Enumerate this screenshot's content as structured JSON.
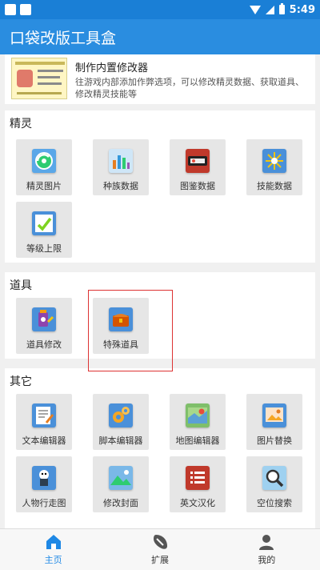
{
  "status_bar": {
    "time": "5:49"
  },
  "app_bar": {
    "title": "口袋改版工具盒"
  },
  "banner": {
    "title": "制作内置修改器",
    "description": "往游戏内部添加作弊选项，可以修改精灵数据、获取道具、修改精灵技能等"
  },
  "sections": {
    "spirit": {
      "title": "精灵",
      "tiles": [
        {
          "label": "精灵图片",
          "icon": "pokeball-refresh-icon"
        },
        {
          "label": "种族数据",
          "icon": "bar-chart-icon"
        },
        {
          "label": "图鉴数据",
          "icon": "pokedex-icon"
        },
        {
          "label": "技能数据",
          "icon": "sparkle-skill-icon"
        },
        {
          "label": "等级上限",
          "icon": "level-up-icon"
        }
      ]
    },
    "items": {
      "title": "道具",
      "tiles": [
        {
          "label": "道具修改",
          "icon": "potion-edit-icon"
        },
        {
          "label": "特殊道具",
          "icon": "treasure-chest-icon"
        }
      ]
    },
    "other": {
      "title": "其它",
      "tiles": [
        {
          "label": "文本编辑器",
          "icon": "text-edit-icon"
        },
        {
          "label": "脚本编辑器",
          "icon": "gears-icon"
        },
        {
          "label": "地图编辑器",
          "icon": "map-pin-icon"
        },
        {
          "label": "图片替换",
          "icon": "image-replace-icon"
        },
        {
          "label": "人物行走图",
          "icon": "character-sprite-icon"
        },
        {
          "label": "修改封面",
          "icon": "cover-landscape-icon"
        },
        {
          "label": "英文汉化",
          "icon": "translate-list-icon"
        },
        {
          "label": "空位搜索",
          "icon": "magnifier-icon"
        }
      ]
    }
  },
  "bottom_nav": [
    {
      "label": "主页",
      "icon": "home-icon",
      "active": true
    },
    {
      "label": "扩展",
      "icon": "extension-icon",
      "active": false
    },
    {
      "label": "我的",
      "icon": "person-icon",
      "active": false
    }
  ],
  "colors": {
    "status_bar": "#1a7fd6",
    "app_bar": "#2a8de0",
    "active_nav": "#1e88e5",
    "highlight_box": "#dd3333"
  }
}
